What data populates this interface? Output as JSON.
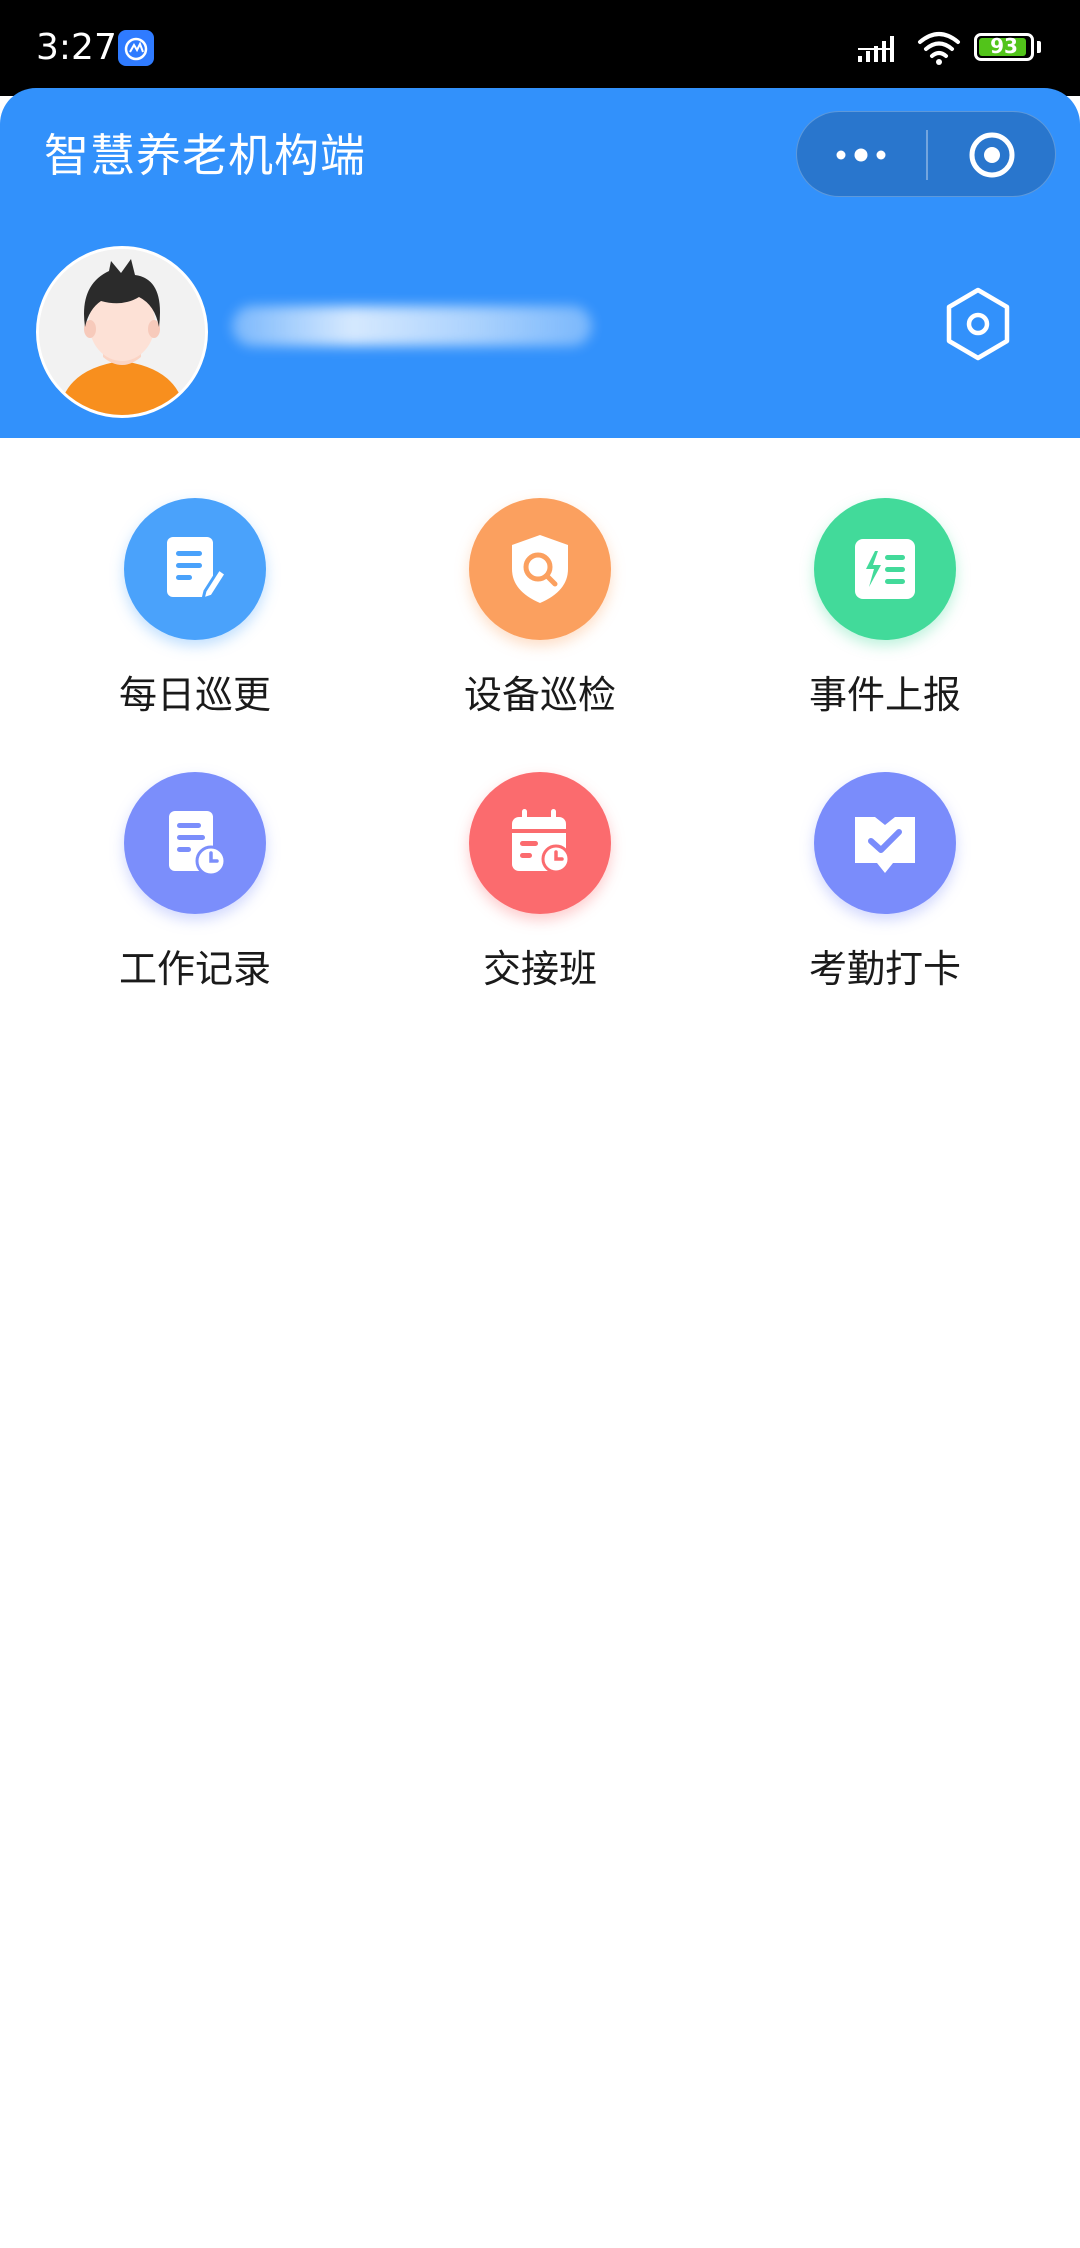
{
  "status_bar": {
    "time": "3:27",
    "battery": "93",
    "icons": [
      "app-badge-icon",
      "signal-icon",
      "wifi-icon",
      "battery-icon"
    ]
  },
  "header": {
    "title": "智慧养老机构端",
    "username": "",
    "colors": {
      "background": "#3291fb"
    },
    "icons": [
      "more-dots-icon",
      "close-target-icon",
      "avatar",
      "settings-hexagon-icon"
    ]
  },
  "menu": {
    "items": [
      {
        "label": "每日巡更",
        "icon": "document-edit-icon",
        "color": "#4aa2fb"
      },
      {
        "label": "设备巡检",
        "icon": "shield-search-icon",
        "color": "#fba05f"
      },
      {
        "label": "事件上报",
        "icon": "report-list-icon",
        "color": "#42da9a"
      },
      {
        "label": "工作记录",
        "icon": "record-clock-icon",
        "color": "#7b8efb"
      },
      {
        "label": "交接班",
        "icon": "calendar-clock-icon",
        "color": "#fb6b6e"
      },
      {
        "label": "考勤打卡",
        "icon": "checkin-icon",
        "color": "#7a8cfb"
      }
    ]
  }
}
